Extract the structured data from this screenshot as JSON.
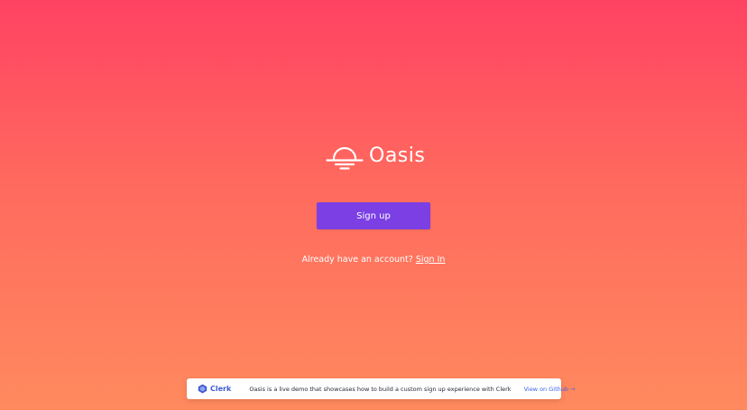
{
  "app": {
    "name": "Oasis",
    "logo_icon": "sunset-icon"
  },
  "auth": {
    "signup_label": "Sign up",
    "already_text": "Already have an account?",
    "signin_label": "Sign In"
  },
  "banner": {
    "brand_name": "Clerk",
    "brand_icon": "clerk-icon",
    "message": "Oasis is a live demo that showcases how to build a custom sign up experience with Clerk",
    "link_label": "View on Github →"
  },
  "colors": {
    "background_top": "#ff4263",
    "background_bottom": "#ff8a5e",
    "button": "#7b3fe4",
    "clerk_brand": "#3e5bd6",
    "banner_link": "#3f63e6"
  }
}
